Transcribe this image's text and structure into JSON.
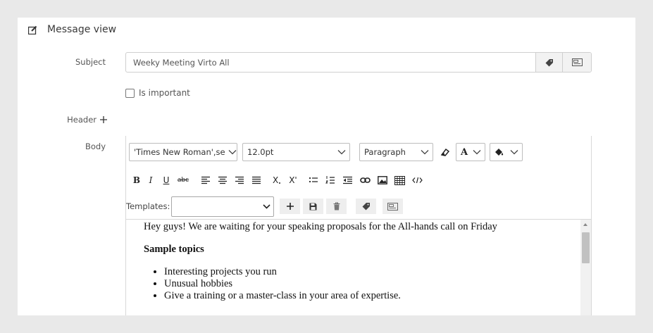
{
  "panel": {
    "title": "Message view",
    "title_icon": "edit-icon"
  },
  "subject": {
    "label": "Subject",
    "value": "Weeky Meeting Virto All",
    "addon_icons": [
      "tag-icon",
      "template-icon"
    ]
  },
  "important": {
    "label": "Is important",
    "checked": false
  },
  "header_field": {
    "label": "Header",
    "add_icon": "plus-icon"
  },
  "body_field": {
    "label": "Body"
  },
  "toolbar": {
    "font_family": "'Times New Roman',se",
    "font_size": "12.0pt",
    "block_format": "Paragraph",
    "text_color_glyph": "A",
    "format_buttons": [
      "B",
      "I",
      "U",
      "abc"
    ],
    "subscript_glyph": "X",
    "templates_label": "Templates:"
  },
  "editor_content": {
    "line1": "Hey guys! We are waiting for your speaking proposals for the All-hands call on Friday",
    "heading": "Sample topics",
    "list": [
      "Interesting projects you run",
      "Unusual hobbies",
      "Give a training or a master-class in your area of expertise."
    ]
  },
  "colors": {
    "background": "#e9e9e9",
    "panel": "#ffffff",
    "border": "#cfcfcf",
    "addon_bg": "#f2f2f2"
  }
}
